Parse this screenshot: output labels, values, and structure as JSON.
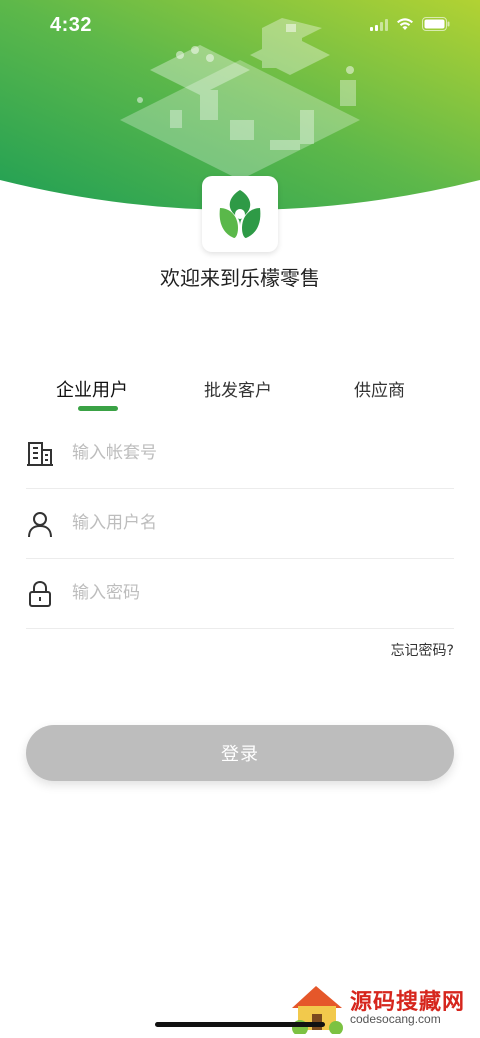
{
  "status_bar": {
    "time": "4:32"
  },
  "header": {
    "welcome_text": "欢迎来到乐檬零售"
  },
  "tabs": [
    {
      "label": "企业用户",
      "active": true
    },
    {
      "label": "批发客户",
      "active": false
    },
    {
      "label": "供应商",
      "active": false
    }
  ],
  "form": {
    "account": {
      "placeholder": "输入帐套号",
      "value": ""
    },
    "username": {
      "placeholder": "输入用户名",
      "value": ""
    },
    "password": {
      "placeholder": "输入密码",
      "value": ""
    },
    "forgot_label": "忘记密码?",
    "login_label": "登录"
  },
  "watermark": {
    "title": "源码搜藏网",
    "subtitle": "codesocang.com"
  },
  "colors": {
    "accent_green": "#3aa245",
    "header_gradient_start": "#1f9f55",
    "header_gradient_end": "#a8cf32",
    "button_disabled": "#bdbdbd"
  },
  "icons": {
    "building": "building-icon",
    "user": "user-icon",
    "lock": "lock-icon",
    "logo": "leaf-logo-icon",
    "wifi": "wifi-icon",
    "signal": "signal-icon",
    "battery": "battery-icon"
  }
}
